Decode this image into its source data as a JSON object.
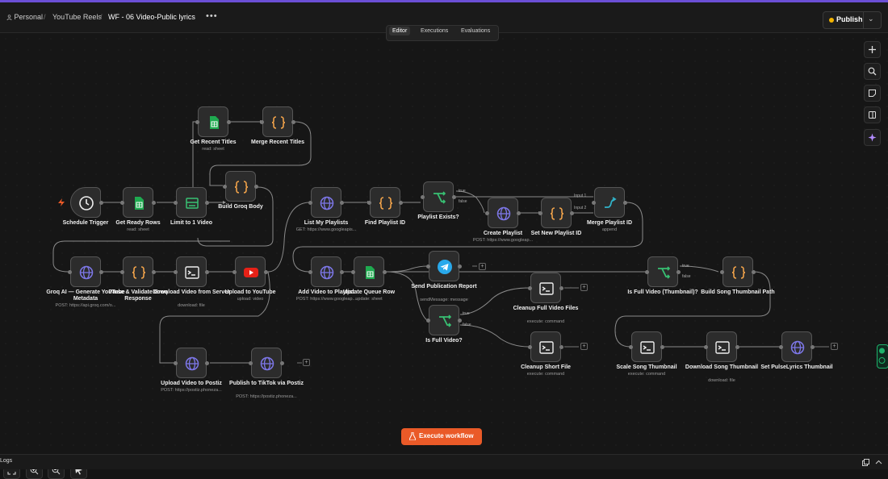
{
  "header": {
    "breadcrumb": [
      {
        "label": "Personal"
      },
      {
        "label": "YouTube Reels"
      }
    ],
    "breadcrumb_separator": "/",
    "workflow_name": "WF - 06 Video-Public lyrics",
    "more_glyph": "•••",
    "publish_label": "Publish",
    "status_color": "#f4b400"
  },
  "tabs": [
    {
      "label": "Editor",
      "active": true
    },
    {
      "label": "Executions",
      "active": false
    },
    {
      "label": "Evaluations",
      "active": false
    }
  ],
  "nodes": [
    {
      "id": "schedule",
      "label": "Schedule Trigger",
      "sub": "",
      "icon": "clock-icon"
    },
    {
      "id": "ready_rows",
      "label": "Get Ready Rows",
      "sub": "read: sheet",
      "icon": "google-sheets-icon"
    },
    {
      "id": "limit",
      "label": "Limit to 1 Video",
      "sub": "",
      "icon": "limit-icon"
    },
    {
      "id": "recent_titles",
      "label": "Get Recent Titles",
      "sub": "read: sheet",
      "icon": "google-sheets-icon"
    },
    {
      "id": "merge_titles",
      "label": "Merge Recent Titles",
      "sub": "",
      "icon": "code-braces-icon"
    },
    {
      "id": "groq_body",
      "label": "Build Groq Body",
      "sub": "",
      "icon": "code-braces-icon"
    },
    {
      "id": "list_playlists",
      "label": "List My Playlists",
      "sub": "GET: https://www.googleapis...",
      "icon": "globe-icon"
    },
    {
      "id": "find_playlist",
      "label": "Find Playlist ID",
      "sub": "",
      "icon": "code-braces-icon"
    },
    {
      "id": "playlist_exists",
      "label": "Playlist Exists?",
      "sub": "",
      "icon": "if-branch-icon"
    },
    {
      "id": "create_playlist",
      "label": "Create Playlist",
      "sub": "POST: https://www.googleap...",
      "icon": "globe-icon"
    },
    {
      "id": "set_playlist",
      "label": "Set New Playlist ID",
      "sub": "",
      "icon": "code-braces-icon"
    },
    {
      "id": "merge_playlist",
      "label": "Merge Playlist ID",
      "sub": "append",
      "icon": "merge-icon"
    },
    {
      "id": "groq_ai",
      "label": "Groq AI — Generate YouTube Metadata",
      "sub": "POST: https://api.groq.com/o...",
      "icon": "globe-icon"
    },
    {
      "id": "parse",
      "label": "Parse & Validate Groq Response",
      "sub": "",
      "icon": "code-braces-icon"
    },
    {
      "id": "download_video",
      "label": "Download Video from Server",
      "sub": "download: file",
      "icon": "terminal-icon"
    },
    {
      "id": "upload_yt",
      "label": "Upload to YouTube",
      "sub": "upload: video",
      "icon": "youtube-icon"
    },
    {
      "id": "add_playlist",
      "label": "Add Video to Playlist",
      "sub": "POST: https://www.googleap...",
      "icon": "globe-icon"
    },
    {
      "id": "update_row",
      "label": "Update Queue Row",
      "sub": "update: sheet",
      "icon": "google-sheets-icon"
    },
    {
      "id": "send_report",
      "label": "Send Publication Report",
      "sub": "sendMessage: message",
      "icon": "telegram-icon"
    },
    {
      "id": "is_full",
      "label": "Is Full Video?",
      "sub": "",
      "icon": "if-branch-icon"
    },
    {
      "id": "cleanup_full",
      "label": "Cleanup Full Video Files",
      "sub": "execute: command",
      "icon": "terminal-icon"
    },
    {
      "id": "cleanup_short",
      "label": "Cleanup Short File",
      "sub": "execute: command",
      "icon": "terminal-icon"
    },
    {
      "id": "is_full_thumb",
      "label": "Is Full Video (Thumbnail)?",
      "sub": "",
      "icon": "if-branch-icon"
    },
    {
      "id": "thumb_path",
      "label": "Build Song Thumbnail Path",
      "sub": "",
      "icon": "code-braces-icon"
    },
    {
      "id": "scale_thumb",
      "label": "Scale Song Thumbnail",
      "sub": "execute: command",
      "icon": "terminal-icon"
    },
    {
      "id": "download_thumb",
      "label": "Download Song Thumbnail",
      "sub": "download: file",
      "icon": "terminal-icon"
    },
    {
      "id": "set_thumb",
      "label": "Set PulseLyrics Thumbnail",
      "sub": "",
      "icon": "globe-icon"
    },
    {
      "id": "postiz_upload",
      "label": "Upload Video to Postiz",
      "sub": "POST: https://postiz.phoneza...",
      "icon": "globe-icon"
    },
    {
      "id": "tiktok",
      "label": "Publish to TikTok via Postiz",
      "sub": "POST: https://postiz.phoneza...",
      "icon": "globe-icon"
    }
  ],
  "edge_labels": {
    "true": "true",
    "false": "false",
    "input1": "Input 1",
    "input2": "Input 2"
  },
  "right_toolbar": [
    "plus-icon",
    "search-icon",
    "sticky-note-icon",
    "panel-icon",
    "ai-sparkle-icon"
  ],
  "zoom_controls": [
    "fit-view-icon",
    "zoom-in-icon",
    "zoom-out-icon",
    "pointer-icon"
  ],
  "execute_label": "Execute workflow",
  "logs_label": "Logs",
  "colors": {
    "accent": "#6b4fd6",
    "execute": "#ea5a28",
    "sheets": "#1faa50",
    "youtube": "#e62117",
    "telegram": "#29a9eb",
    "code": "#f0a24a",
    "http": "#7d77e8",
    "if": "#38c173",
    "merge": "#31b3c9"
  }
}
